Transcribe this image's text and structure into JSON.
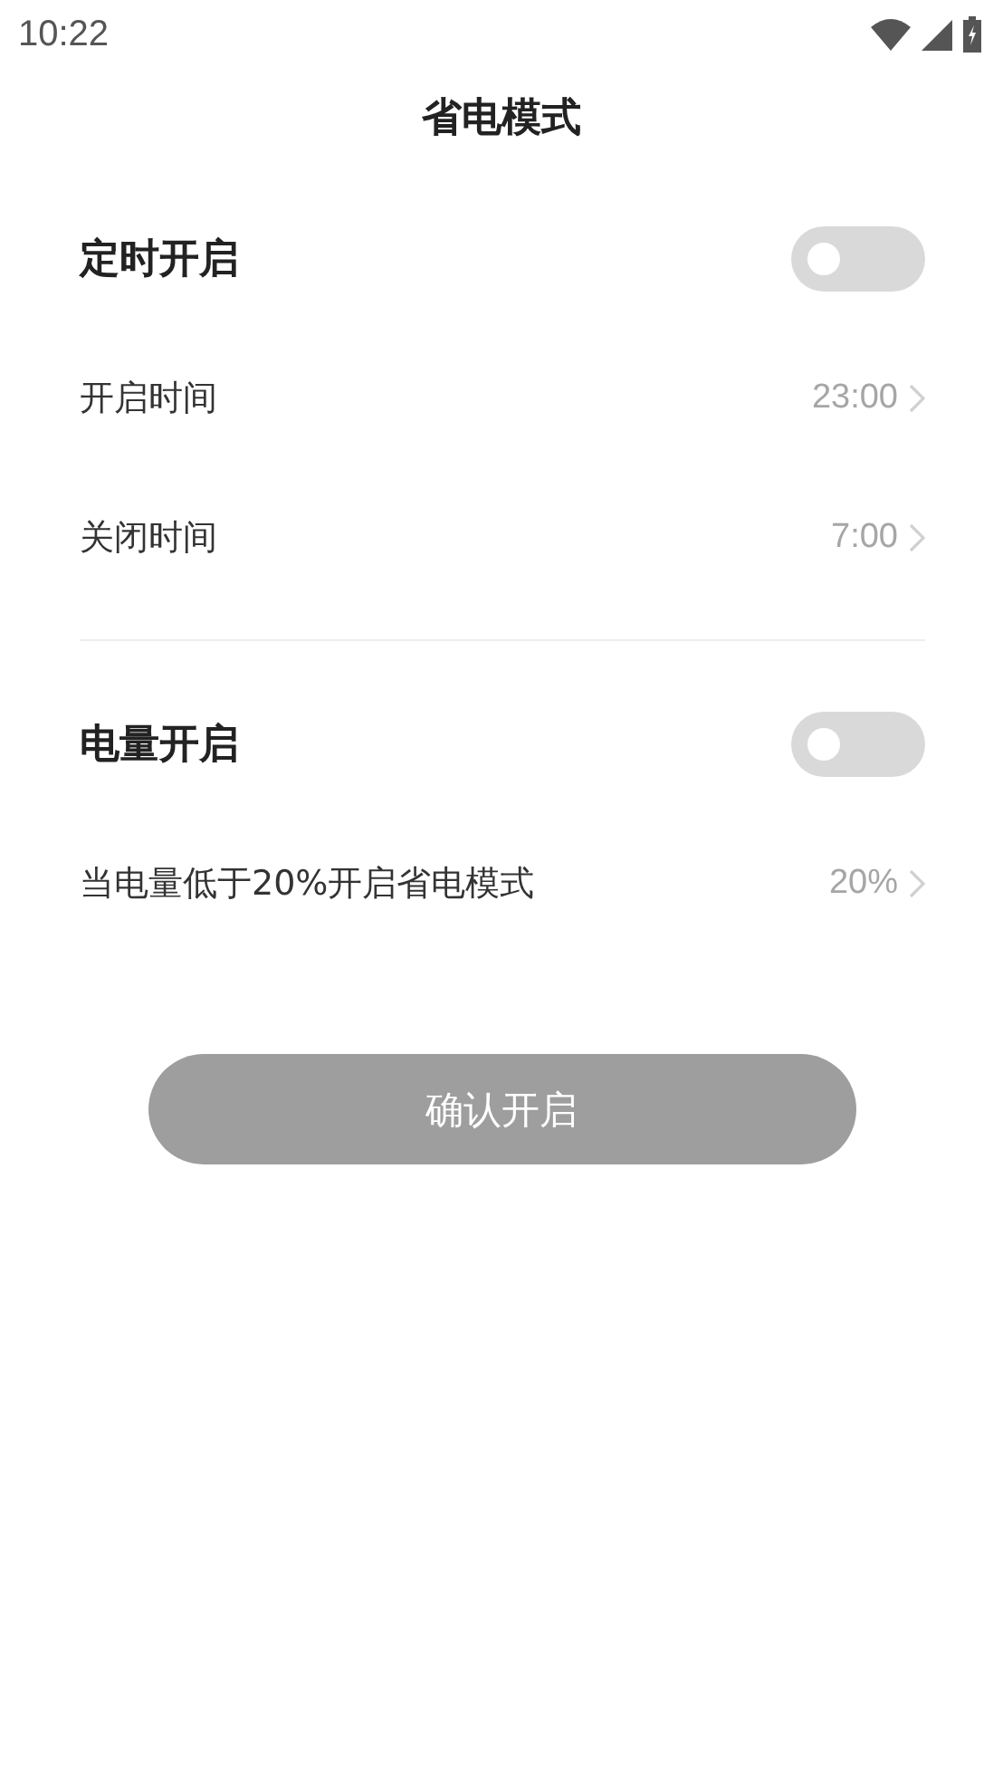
{
  "status_bar": {
    "time": "10:22"
  },
  "title": "省电模式",
  "sections": [
    {
      "label": "定时开启",
      "on": false,
      "rows": [
        {
          "label": "开启时间",
          "value": "23:00"
        },
        {
          "label": "关闭时间",
          "value": "7:00"
        }
      ]
    },
    {
      "label": "电量开启",
      "on": false,
      "rows": [
        {
          "label": "当电量低于20%开启省电模式",
          "value": "20%"
        }
      ]
    }
  ],
  "confirm_button": {
    "label": "确认开启",
    "disabled": true
  }
}
